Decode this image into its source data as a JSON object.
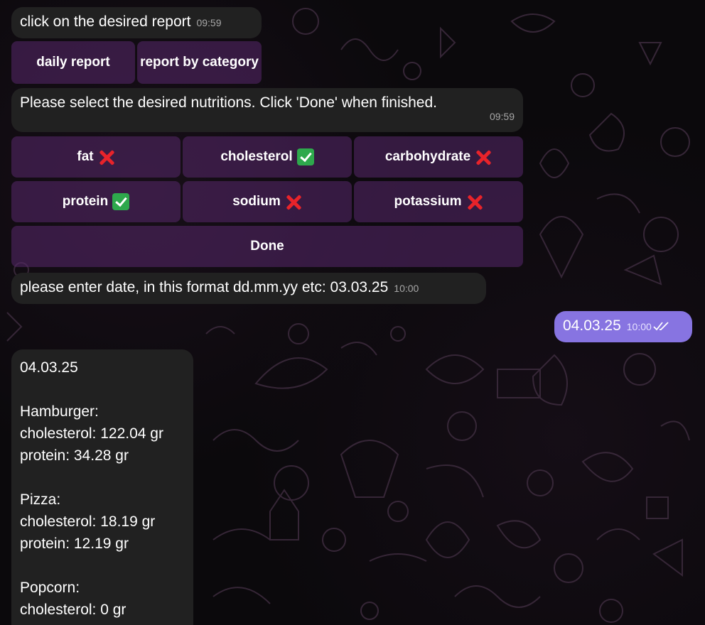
{
  "messages": {
    "m1": {
      "text": "click on the desired report",
      "time": "09:59"
    },
    "m2": {
      "text": "Please select the desired nutritions. Click 'Done' when finished.",
      "time": "09:59"
    },
    "m3": {
      "text": "please enter date, in this format dd.mm.yy etc: 03.03.25",
      "time": "10:00"
    },
    "m4": {
      "text": "04.03.25",
      "time": "10:00"
    }
  },
  "report_buttons": {
    "daily": "daily report",
    "category": "report by category"
  },
  "nutrition_buttons": [
    {
      "label": "fat",
      "selected": false
    },
    {
      "label": "cholesterol",
      "selected": true
    },
    {
      "label": "carbohydrate",
      "selected": false
    },
    {
      "label": "protein",
      "selected": true
    },
    {
      "label": "sodium",
      "selected": false
    },
    {
      "label": "potassium",
      "selected": false
    }
  ],
  "done_label": "Done",
  "report": {
    "date": "04.03.25",
    "items": [
      {
        "name": "Hamburger:",
        "lines": [
          "cholesterol: 122.04 gr",
          "protein: 34.28 gr"
        ]
      },
      {
        "name": "Pizza:",
        "lines": [
          "cholesterol: 18.19 gr",
          "protein: 12.19 gr"
        ]
      },
      {
        "name": "Popcorn:",
        "lines": [
          "cholesterol: 0 gr"
        ]
      }
    ]
  },
  "colors": {
    "incoming_bubble": "#212121",
    "outgoing_bubble": "#8774e1",
    "keyboard_button": "#3a1f47",
    "check": "#2ea84c",
    "cross": "#e8232a"
  }
}
